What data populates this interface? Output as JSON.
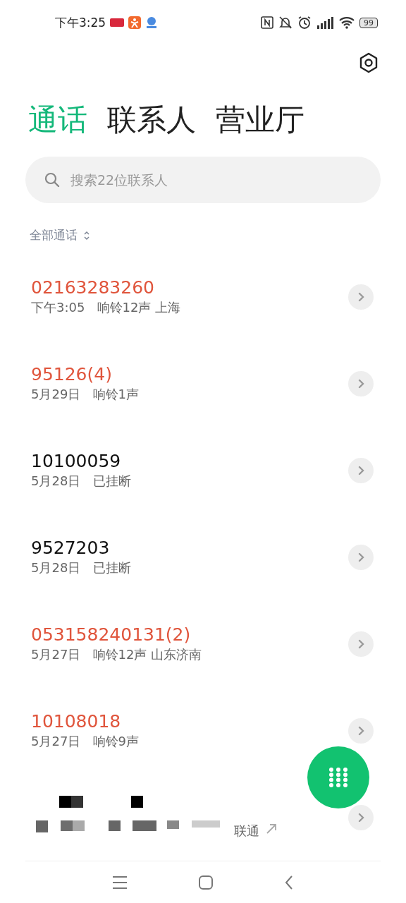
{
  "status_bar": {
    "time": "下午3:25",
    "battery": "99"
  },
  "tabs": [
    {
      "label": "通话",
      "selected": true
    },
    {
      "label": "联系人",
      "selected": false
    },
    {
      "label": "营业厅",
      "selected": false
    }
  ],
  "search": {
    "placeholder": "搜索22位联系人"
  },
  "filter": {
    "label": "全部通话"
  },
  "calls": [
    {
      "number": "02163283260",
      "missed": true,
      "time": "下午3:05",
      "detail": "响铃12声 上海"
    },
    {
      "number": "95126(4)",
      "missed": true,
      "time": "5月29日",
      "detail": "响铃1声"
    },
    {
      "number": "10100059",
      "missed": false,
      "time": "5月28日",
      "detail": "已挂断"
    },
    {
      "number": "9527203",
      "missed": false,
      "time": "5月28日",
      "detail": "已挂断"
    },
    {
      "number": "053158240131(2)",
      "missed": true,
      "time": "5月27日",
      "detail": "响铃12声 山东济南"
    },
    {
      "number": "10108018",
      "missed": true,
      "time": "5月27日",
      "detail": "响铃9声"
    }
  ],
  "redacted_call": {
    "detail": "联通"
  }
}
